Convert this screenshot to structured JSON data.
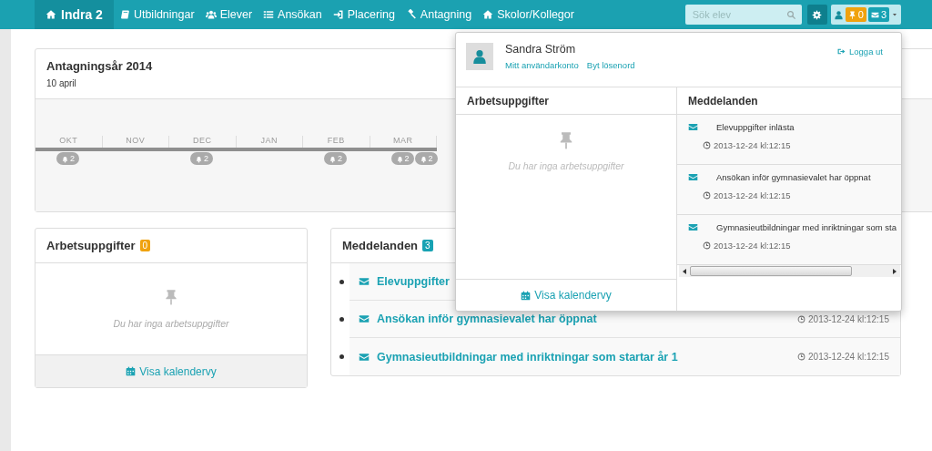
{
  "navbar": {
    "brand": "Indra 2",
    "items": [
      {
        "label": "Utbildningar"
      },
      {
        "label": "Elever"
      },
      {
        "label": "Ansökan"
      },
      {
        "label": "Placering"
      },
      {
        "label": "Antagning"
      },
      {
        "label": "Skolor/Kollegor"
      }
    ],
    "search": {
      "placeholder": "Sök elev"
    },
    "tasks_count": "0",
    "messages_count": "3",
    "menu_expanded": true
  },
  "timeline": {
    "title": "Antagningsår 2014",
    "date": "10 april",
    "months": [
      {
        "label": "OKT",
        "events": [
          "2"
        ]
      },
      {
        "label": "NOV"
      },
      {
        "label": "DEC",
        "events": [
          "2"
        ]
      },
      {
        "label": "JAN"
      },
      {
        "label": "FEB",
        "events": [
          "2"
        ]
      },
      {
        "label": "MAR",
        "events": [
          "2",
          "2"
        ]
      }
    ]
  },
  "tasks": {
    "title": "Arbetsuppgifter",
    "count": "0",
    "empty_text": "Du har inga arbetsuppgifter",
    "link": "Visa kalendervy"
  },
  "messages": {
    "title": "Meddelanden",
    "count": "3",
    "items": [
      {
        "title": "Elevuppgifter"
      },
      {
        "title": "Ansökan inför gymnasievalet har öppnat",
        "time": "2013-12-24 kl:12:15"
      },
      {
        "title": "Gymnasieutbildningar med inriktningar som startar år 1",
        "time": "2013-12-24 kl:12:15"
      }
    ]
  },
  "user_menu": {
    "name": "Sandra Ström",
    "links": [
      "Mitt användarkonto",
      "Byt lösenord"
    ],
    "logout": "Logga ut",
    "tasks": {
      "title": "Arbetsuppgifter",
      "empty_text": "Du har inga arbetsuppgifter",
      "link": "Visa kalendervy"
    },
    "messages": {
      "title": "Meddelanden",
      "items": [
        {
          "title": "Elevuppgifter inlästa",
          "time": "2013-12-24 kl:12:15"
        },
        {
          "title": "Ansökan inför gymnasievalet har öppnat",
          "time": "2013-12-24 kl:12:15"
        },
        {
          "title": "Gymnasieutbildningar med inriktningar som sta",
          "time": "2013-12-24 kl:12:15"
        }
      ]
    }
  }
}
